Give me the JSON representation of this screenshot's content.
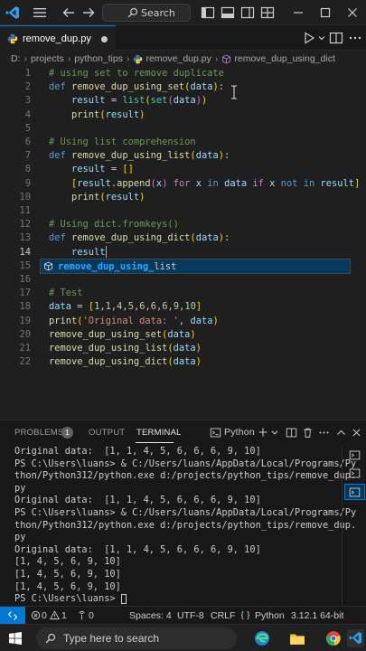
{
  "titlebar": {
    "search_label": "Search"
  },
  "tab": {
    "filename": "remove_dup.py"
  },
  "breadcrumb": {
    "drive": "D:",
    "folders": [
      "projects",
      "python_tips"
    ],
    "file": "remove_dup.py",
    "symbol": "remove_dup_using_dict"
  },
  "editor": {
    "current_line": 14,
    "suggestion": {
      "match": "remove_dup_using_",
      "rest": "list"
    }
  },
  "panel": {
    "tabs": {
      "problems": "PROBLEMS",
      "problems_count": "1",
      "output": "OUTPUT",
      "terminal": "TERMINAL"
    },
    "terminal_name": "Python",
    "terminal_lines": [
      "Original data:  [1, 1, 4, 5, 6, 6, 6, 9, 10]",
      "PS C:\\Users\\luans> & C:/Users/luans/AppData/Local/Programs/Py",
      "thon/Python312/python.exe d:/projects/python_tips/remove_dup.",
      "py",
      "Original data:  [1, 1, 4, 5, 6, 6, 6, 9, 10]",
      "PS C:\\Users\\luans> & C:/Users/luans/AppData/Local/Programs/Py",
      "thon/Python312/python.exe d:/projects/python_tips/remove_dup.",
      "py",
      "Original data:  [1, 1, 4, 5, 6, 6, 6, 9, 10]",
      "[1, 4, 5, 6, 9, 10]",
      "[1, 4, 5, 6, 9, 10]",
      "[1, 4, 5, 6, 9, 10]",
      "PS C:\\Users\\luans> "
    ]
  },
  "statusbar": {
    "errors": "0",
    "warnings": "1",
    "ports": "0",
    "spaces": "Spaces: 4",
    "encoding": "UTF-8",
    "eol": "CRLF",
    "language": "Python",
    "interpreter": "3.12.1 64-bit"
  },
  "taskbar": {
    "search_placeholder": "Type here to search"
  },
  "colors": {
    "accent": "#0078d4",
    "background": "#1f1f1f"
  }
}
